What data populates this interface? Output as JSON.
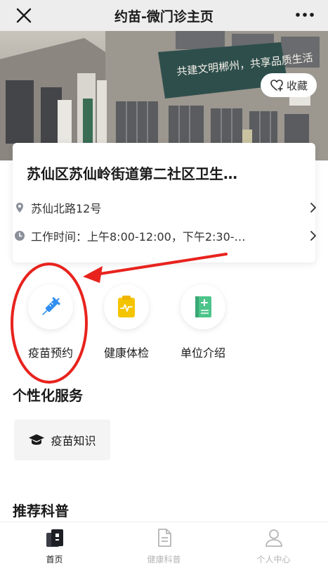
{
  "titlebar": {
    "title": "约苗-微门诊主页",
    "close_icon": "close-icon",
    "more_icon": "more-icon"
  },
  "banner": {
    "sign_text": "共建文明郴州，共享品质生活",
    "favorite_label": "收藏"
  },
  "clinic": {
    "name": "苏仙区苏仙岭街道第二社区卫生…",
    "address": "苏仙北路12号",
    "hours": "工作时间：上午8:00-12:00，下午2:30-…"
  },
  "quick_actions": [
    {
      "label": "疫苗预约",
      "icon": "syringe-icon",
      "color": "#2f8ef0"
    },
    {
      "label": "健康体检",
      "icon": "clipboard-heartbeat-icon",
      "color": "#f5c400"
    },
    {
      "label": "单位介绍",
      "icon": "medical-book-icon",
      "color": "#4cc48a"
    }
  ],
  "sections": {
    "personalized_services": "个性化服务",
    "recommended": "推荐科普"
  },
  "services": [
    {
      "label": "疫苗知识",
      "icon": "graduation-cap-icon"
    }
  ],
  "tabbar": [
    {
      "label": "首页",
      "active": true
    },
    {
      "label": "健康科普",
      "active": false
    },
    {
      "label": "个人中心",
      "active": false
    }
  ],
  "colors": {
    "annotation_red": "#e8231e",
    "accent_blue": "#2f8ef0"
  }
}
